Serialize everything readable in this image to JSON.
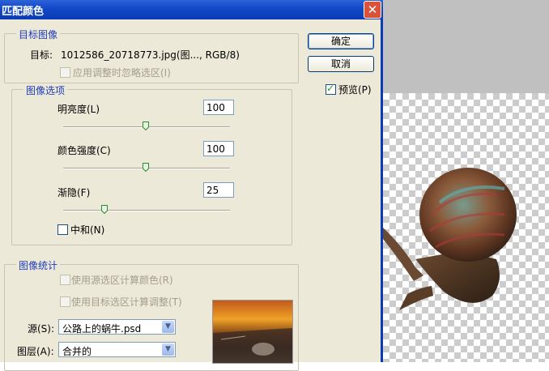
{
  "window": {
    "title": "匹配颜色"
  },
  "target_image": {
    "legend": "目标图像",
    "target_label": "目标:",
    "target_value": "1012586_20718773.jpg(图..., RGB/8)",
    "ignore_selection_label": "应用调整时忽略选区(I)",
    "ignore_selection_checked": false
  },
  "image_options": {
    "legend": "图像选项",
    "brightness": {
      "label": "明亮度(L)",
      "value": "100",
      "slider_fraction": 0.5
    },
    "color_intensity": {
      "label": "颜色强度(C)",
      "value": "100",
      "slider_fraction": 0.5
    },
    "fade": {
      "label": "渐隐(F)",
      "value": "25",
      "slider_fraction": 0.25
    },
    "neutralize": {
      "label": "中和(N)",
      "checked": false
    }
  },
  "image_statistics": {
    "legend": "图像统计",
    "use_source_selection_label": "使用源选区计算颜色(R)",
    "use_target_selection_label": "使用目标选区计算调整(T)",
    "source_label": "源(S):",
    "source_value": "公路上的蜗牛.psd",
    "layer_label": "图层(A):",
    "layer_value": "合并的"
  },
  "buttons": {
    "ok": "确定",
    "cancel": "取消"
  },
  "preview": {
    "label": "预览(P)",
    "checked": true
  }
}
